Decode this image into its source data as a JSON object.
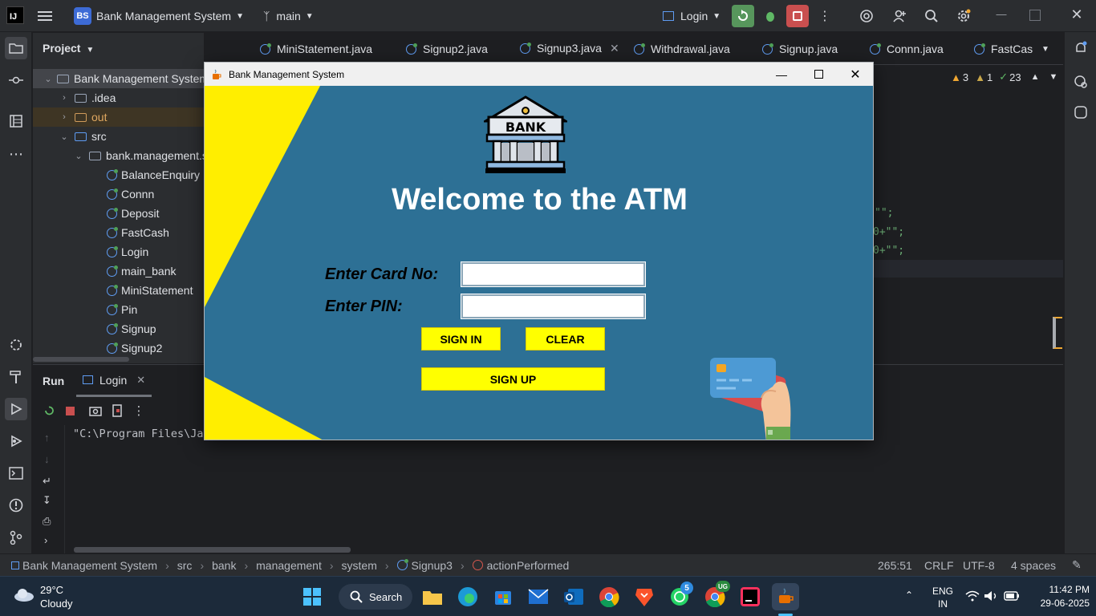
{
  "ide": {
    "logo": "IJ",
    "project_badge": "BS",
    "project_name": "Bank Management System",
    "branch": "main",
    "run_config": "Login"
  },
  "project_pane": {
    "title": "Project",
    "tree": [
      {
        "label": "Bank Management System",
        "type": "folder"
      },
      {
        "label": ".idea",
        "type": "folder"
      },
      {
        "label": "out",
        "type": "folder"
      },
      {
        "label": "src",
        "type": "folder"
      },
      {
        "label": "bank.management.system",
        "type": "package"
      },
      {
        "label": "BalanceEnquiry",
        "type": "class"
      },
      {
        "label": "Connn",
        "type": "class"
      },
      {
        "label": "Deposit",
        "type": "class"
      },
      {
        "label": "FastCash",
        "type": "class"
      },
      {
        "label": "Login",
        "type": "class"
      },
      {
        "label": "main_bank",
        "type": "class"
      },
      {
        "label": "MiniStatement",
        "type": "class"
      },
      {
        "label": "Pin",
        "type": "class"
      },
      {
        "label": "Signup",
        "type": "class"
      },
      {
        "label": "Signup2",
        "type": "class"
      }
    ]
  },
  "editor_tabs": [
    {
      "label": "MiniStatement.java"
    },
    {
      "label": "Signup2.java"
    },
    {
      "label": "Signup3.java"
    },
    {
      "label": "Withdrawal.java"
    },
    {
      "label": "Signup.java"
    },
    {
      "label": "Connn.java"
    },
    {
      "label": "FastCas"
    }
  ],
  "inspections": {
    "warnings": "3",
    "weak": "1",
    "typos": "23"
  },
  "code_fragments": {
    "line1": "\"\";",
    "line2": "0+\"\";",
    "line3": "0+\"\";"
  },
  "run_panel": {
    "title": "Run",
    "tab": "Login",
    "console_line": "\"C:\\Program Files\\Java\\jdk\\bin\\java.exe\" -javaagent:C:\\Program Files\\JetBrains\\IntelliJ IDEA\\lib\\idea_rt.jar=55164\" -Dfile"
  },
  "statusbar": {
    "crumbs": [
      "Bank Management System",
      "src",
      "bank",
      "management",
      "system",
      "Signup3",
      "actionPerformed"
    ],
    "position": "265:51",
    "line_sep": "CRLF",
    "encoding": "UTF-8",
    "indent": "4 spaces"
  },
  "swing_window": {
    "title": "Bank Management System",
    "bank_text": "BANK",
    "heading": "Welcome to the ATM",
    "card_label": "Enter Card No:",
    "pin_label": "Enter PIN:",
    "card_value": "",
    "pin_value": "",
    "sign_in": "SIGN IN",
    "clear": "CLEAR",
    "sign_up": "SIGN UP",
    "bg_color": "#2d7095",
    "accent_color": "#ffff00"
  },
  "taskbar": {
    "weather_temp": "29°C",
    "weather_desc": "Cloudy",
    "search": "Search",
    "whatsapp_badge": "5",
    "chrome_badge": "UG",
    "lang1": "ENG",
    "lang2": "IN",
    "time": "11:42 PM",
    "date": "29-06-2025"
  }
}
